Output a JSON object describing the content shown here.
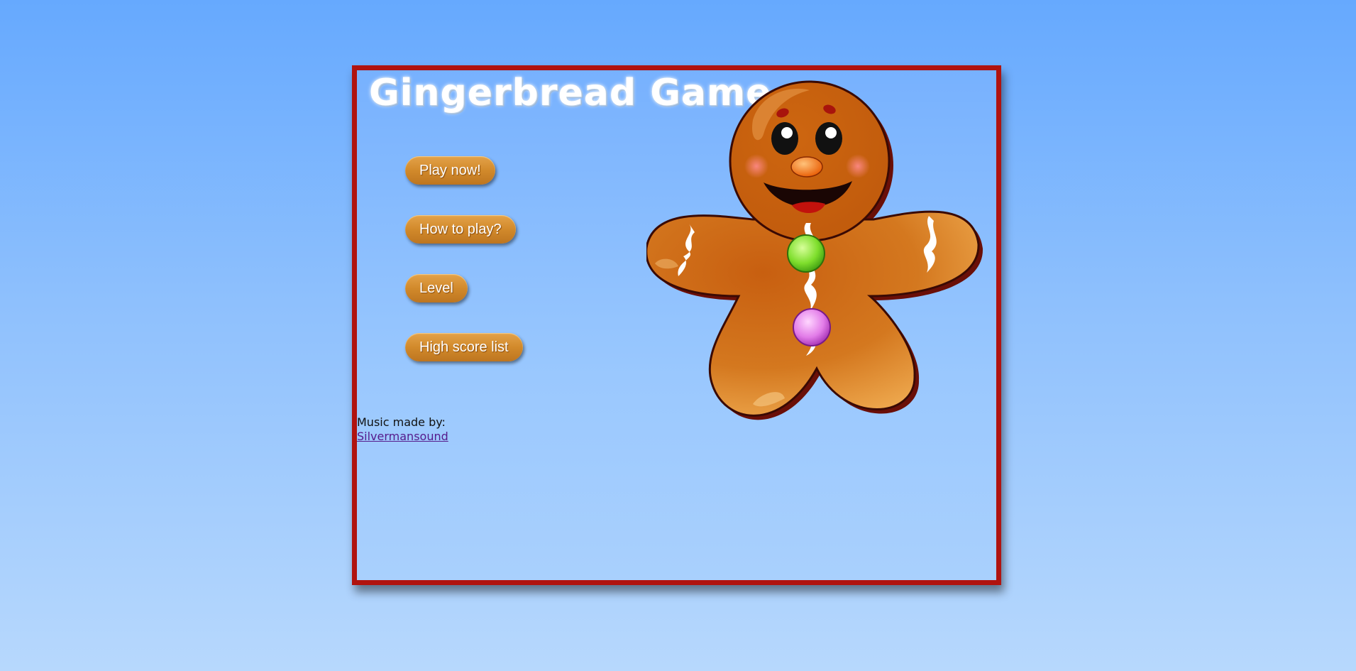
{
  "game": {
    "title": "Gingerbread Game",
    "menu": [
      {
        "label": "Play now!"
      },
      {
        "label": "How to play?"
      },
      {
        "label": "Level"
      },
      {
        "label": "High score list"
      }
    ],
    "credits": {
      "text": "Music made by:",
      "link_text": "Silvermansound"
    },
    "mascot_icon": "gingerbread-man-icon"
  },
  "colors": {
    "frame_border": "#b0130f",
    "button": "#d28a2b",
    "gingerbread": "#d2731c"
  }
}
